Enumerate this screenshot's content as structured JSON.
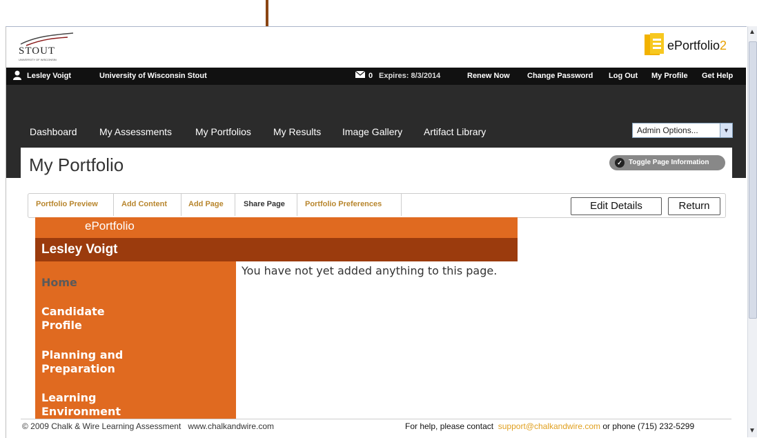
{
  "header": {
    "school_name": "STOUT",
    "school_sub": "UNIVERSITY OF WISCONSIN",
    "brand_name": "ePortfolio",
    "brand_suffix": "2"
  },
  "userbar": {
    "user_name": "Lesley Voigt",
    "institution": "University of Wisconsin Stout",
    "message_count": "0",
    "expires_label": "Expires:",
    "expires_date": "8/3/2014",
    "links": {
      "renew": "Renew Now",
      "change_password": "Change Password",
      "logout": "Log Out",
      "profile": "My Profile",
      "help": "Get Help"
    }
  },
  "nav": {
    "items": [
      "Dashboard",
      "My Assessments",
      "My Portfolios",
      "My Results",
      "Image Gallery",
      "Artifact Library"
    ],
    "admin_select": "Admin Options..."
  },
  "page": {
    "title": "My Portfolio",
    "toggle_label": "Toggle Page Information"
  },
  "tabs": {
    "items": [
      "Portfolio Preview",
      "Add Content",
      "Add Page",
      "Share Page",
      "Portfolio Preferences"
    ],
    "active": "Share Page",
    "edit_details": "Edit Details",
    "return": "Return"
  },
  "preview": {
    "brand": "ePortfolio",
    "owner": "Lesley Voigt",
    "menu": [
      "Home",
      "Candidate Profile",
      "Planning and Preparation",
      "Learning Environment"
    ],
    "active_menu": "Home",
    "empty_message": "You have not yet added anything to this page."
  },
  "footer": {
    "copyright": "© 2009 Chalk & Wire Learning Assessment",
    "site": "www.chalkandwire.com",
    "help_prefix": "For help, please contact",
    "support_email": "support@chalkandwire.com",
    "help_suffix": "or phone (715) 232-5299"
  },
  "colors": {
    "accent_orange": "#e06a20",
    "dark_orange": "#9b3b0d",
    "tab_text": "#b8862e",
    "annotation_arrow": "#8a4513"
  }
}
